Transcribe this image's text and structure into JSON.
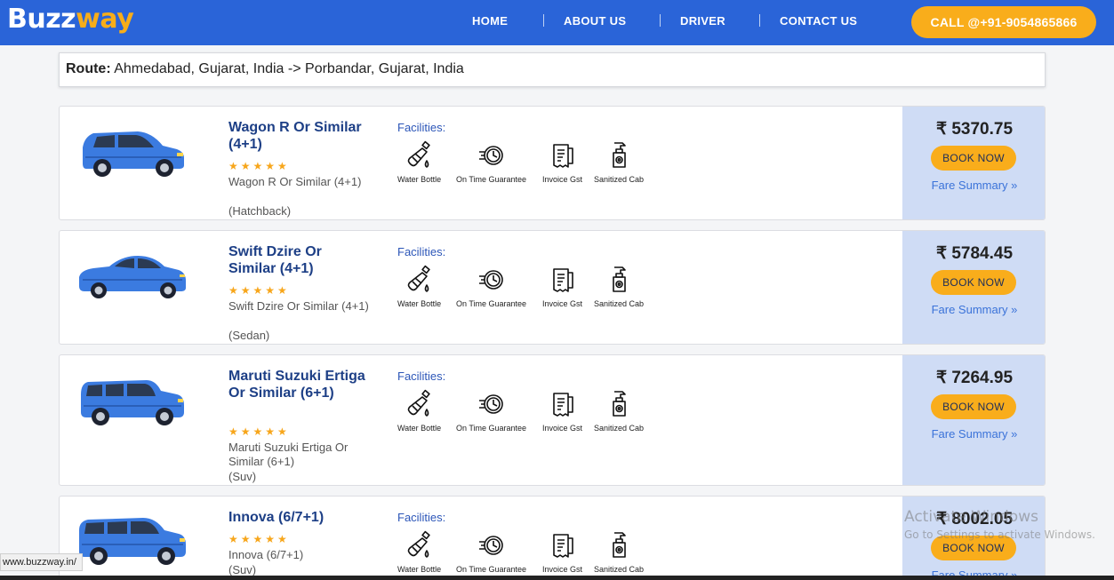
{
  "header": {
    "logo_part1": "Buzz",
    "logo_part2": "way",
    "nav": [
      "HOME",
      "ABOUT US",
      "DRIVER",
      "CONTACT US"
    ],
    "call_label": "CALL @+91-9054865866"
  },
  "route": {
    "label": "Route:",
    "value": "Ahmedabad, Gujarat, India -> Porbandar, Gujarat, India"
  },
  "facilities": {
    "title": "Facilities:",
    "items": [
      "Water Bottle",
      "On Time Guarantee",
      "Invoice Gst",
      "Sanitized Cab"
    ]
  },
  "cars": [
    {
      "name": "Wagon R Or Similar (4+1)",
      "rating": 5,
      "stars": "★★★★★",
      "desc": "Wagon R Or Similar (4+1)",
      "type": "(Hatchback)",
      "price": "₹ 5370.75",
      "icon": "hatchback-car-icon"
    },
    {
      "name": "Swift Dzire Or Similar (4+1)",
      "rating": 5,
      "stars": "★★★★★",
      "desc": "Swift Dzire Or Similar (4+1)",
      "type": "(Sedan)",
      "price": "₹ 5784.45",
      "icon": "sedan-car-icon"
    },
    {
      "name": "Maruti Suzuki Ertiga Or Similar (6+1)",
      "rating": 5,
      "stars": "★★★★★",
      "desc": "Maruti Suzuki Ertiga Or Similar (6+1)",
      "type": "(Suv)",
      "price": "₹ 7264.95",
      "icon": "suv-car-icon"
    },
    {
      "name": "Innova (6/7+1)",
      "rating": 5,
      "stars": "★★★★★",
      "desc": "Innova (6/7+1)",
      "type": "(Suv)",
      "price": "₹ 8002.05",
      "icon": "mpv-car-icon"
    }
  ],
  "buttons": {
    "book": "BOOK NOW",
    "fare": "Fare Summary »"
  },
  "status_url": "www.buzzway.in/",
  "watermark": {
    "line1": "Activate Windows",
    "line2": "Go to Settings to activate Windows."
  },
  "colors": {
    "header_bg": "#2a64d8",
    "accent": "#f9ad1b",
    "price_bg": "#cfdcf5",
    "car_blue": "#3b7be0"
  }
}
